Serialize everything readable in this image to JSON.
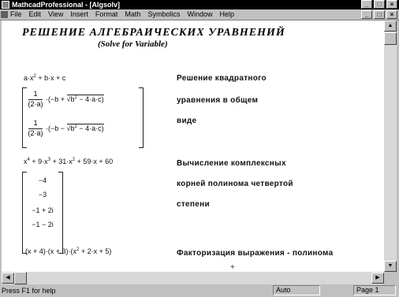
{
  "window": {
    "title": "MathcadProfessional - [Algsolv]",
    "min_glyph": "_",
    "max_glyph": "□",
    "close_glyph": "×"
  },
  "menu": {
    "items": [
      "File",
      "Edit",
      "View",
      "Insert",
      "Format",
      "Math",
      "Symbolics",
      "Window",
      "Help"
    ]
  },
  "worksheet": {
    "heading": "РЕШЕНИЕ АЛГЕБРАИЧЕСКИХ УРАВНЕНИЙ",
    "subheading": "(Solve for Variable)",
    "expr1": {
      "a": "a·x",
      "exp2": "2",
      "rest": " + b·x + c",
      "num": "1",
      "den": "(2·a)",
      "sol1_left": "·(−b + ",
      "sol1_radicand": "b",
      "sol1_tail": " − 4·a·c)",
      "sol2_left": "·(−b − ",
      "sol2_radicand": "b",
      "sol2_tail": " − 4·a·c)"
    },
    "text1": [
      "Решение квадратного",
      "уравнения в общем",
      "виде"
    ],
    "expr2": {
      "poly": "x",
      "p4": "4",
      "t2": " + 9·x",
      "p3": "3",
      "t3": " + 31·x",
      "p2": "2",
      "t4": " + 59·x + 60",
      "roots": [
        "−4",
        "−3",
        "−1 + 2i",
        "−1 − 2i"
      ]
    },
    "text2": [
      "Вычисление комплексных",
      "корней полинома четвертой",
      "степени"
    ],
    "expr3": {
      "lead": "(x + 4)·(x + 3)·(x",
      "p2": "2",
      "tail": " + 2·x + 5)"
    },
    "text3": "Факторизация выражения - полинома",
    "cursor": "+"
  },
  "status": {
    "help": "Press F1 for help",
    "mode": "Auto",
    "page": "Page 1"
  }
}
